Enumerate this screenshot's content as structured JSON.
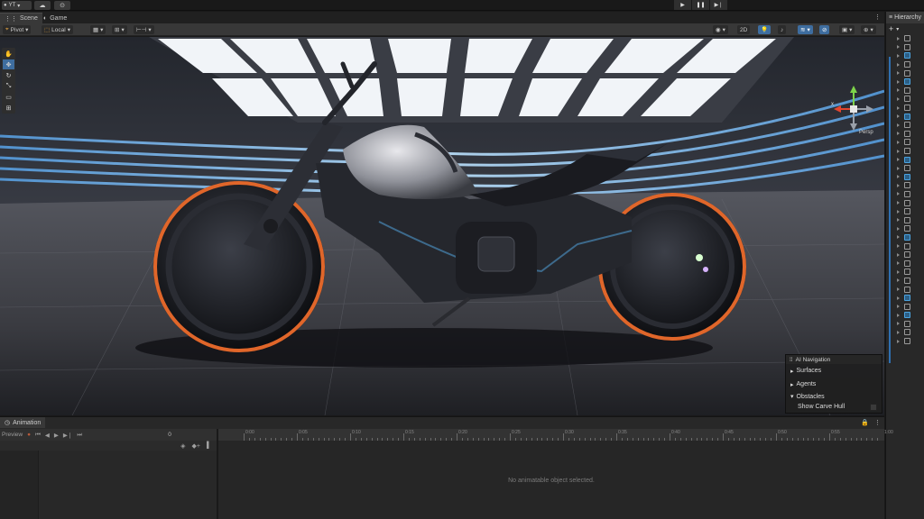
{
  "toolbar": {
    "account_label": "YT",
    "play_icons": [
      "play-icon",
      "pause-icon",
      "step-icon"
    ]
  },
  "scene_tabs": [
    {
      "label": "Scene",
      "icon": "grid-icon"
    },
    {
      "label": "Game",
      "icon": "gamepad-icon"
    }
  ],
  "scene_toolbar": {
    "pivot_label": "Pivot",
    "local_label": "Local",
    "mode_2d_label": "2D"
  },
  "gizmo": {
    "axis_x": "x",
    "view_label": "Persp"
  },
  "ai_navigation": {
    "title": "AI Navigation",
    "items": [
      {
        "label": "Surfaces",
        "expanded": false
      },
      {
        "label": "Agents",
        "expanded": false
      },
      {
        "label": "Obstacles",
        "expanded": true
      }
    ],
    "show_carve_hull_label": "Show Carve Hull"
  },
  "hierarchy": {
    "tab_label": "Hierarchy",
    "add_label": "+"
  },
  "animation": {
    "tab_label": "Animation",
    "preview_label": "Preview",
    "frame_value": "0",
    "empty_message": "No animatable object selected.",
    "ruler_labels": [
      "0:00",
      "0:05",
      "0:10",
      "0:15",
      "0:20",
      "0:25",
      "0:30",
      "0:35",
      "0:40",
      "0:45",
      "0:50",
      "0:55",
      "1:00"
    ]
  },
  "colors": {
    "accent_blue": "#3e6d9f",
    "wheel_rim": "#e0662a",
    "light_strip": "#7fc4ff"
  }
}
